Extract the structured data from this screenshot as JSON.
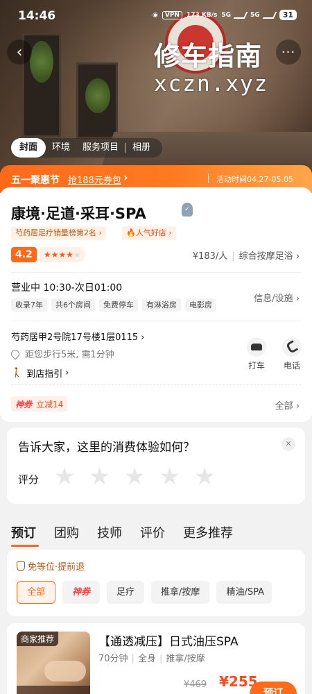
{
  "status_bar": {
    "time": "14:46",
    "vpn": "VPN",
    "speed": "173 KB/s",
    "net1": "5G",
    "net2": "5G",
    "battery": "31"
  },
  "hero": {
    "watermark_title": "修车指南",
    "watermark_url": "xczn.xyz",
    "tabs": [
      "封面",
      "环境",
      "服务项目",
      "相册"
    ],
    "active_tab": 0
  },
  "promo": {
    "title": "五一聚惠节",
    "coupon": "抢188元券包",
    "time": "活动时间04.27-05.05"
  },
  "shop": {
    "name": "康境·足道·采耳·SPA",
    "rank_tag": "芍药居足疗销量榜第2名",
    "hot_tag": "人气好店",
    "rating": "4.2",
    "stars_filled": 4,
    "stars_total": 5,
    "price": "¥183/人",
    "category": "综合按摩足浴",
    "hours": "营业中 10:30-次日01:00",
    "facilities": [
      "收录7年",
      "共6个房间",
      "免费停车",
      "有淋浴房",
      "电影房"
    ],
    "info_link": "信息/设施",
    "address": "芍药居甲2号院17号楼1层0115",
    "distance": "距您步行5米, 需1分钟",
    "route": "到店指引",
    "taxi": "打车",
    "phone": "电话",
    "coupon_brand": "神券",
    "coupon_text": "立减14",
    "all_link": "全部"
  },
  "review": {
    "question": "告诉大家，这里的消费体验如何？",
    "label": "评分",
    "star_glyph": "★"
  },
  "section_tabs": [
    "预订",
    "团购",
    "技师",
    "评价",
    "更多推荐"
  ],
  "booking": {
    "badge": "免等位·提前退",
    "filters": [
      "全部",
      "神券",
      "足疗",
      "推拿/按摩",
      "精油/SPA"
    ]
  },
  "product": {
    "merchant_tag": "商家推荐",
    "title": "【通透减压】日式油压SPA",
    "duration": "70分钟",
    "body": "全身",
    "type": "推拿/按摩",
    "orig_price": "¥469",
    "price": "¥255",
    "book": "预订"
  },
  "colors": {
    "accent": "#ff6a1a",
    "coupon_red": "#ff3d3d"
  }
}
